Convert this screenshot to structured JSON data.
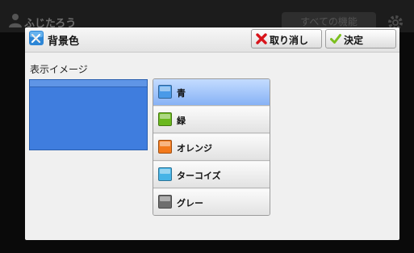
{
  "background_app": {
    "user_name": "ふじたろう",
    "all_features_label": "すべての機能",
    "user_icon": "user-icon",
    "gear_icon": "gear-icon"
  },
  "dialog": {
    "title": "背景色",
    "title_icon": "settings-tools-icon",
    "cancel_label": "取り消し",
    "cancel_icon": "cancel-x-icon",
    "ok_label": "決定",
    "ok_icon": "checkmark-icon",
    "preview_label": "表示イメージ",
    "preview_color": "#3f7dde",
    "selected_index": 0,
    "colors": [
      {
        "label": "青",
        "swatch": "#4a9ae8"
      },
      {
        "label": "緑",
        "swatch": "#6ab81e"
      },
      {
        "label": "オレンジ",
        "swatch": "#f37a1d"
      },
      {
        "label": "ターコイズ",
        "swatch": "#46b3e6"
      },
      {
        "label": "グレー",
        "swatch": "#6e6e6e"
      }
    ]
  }
}
